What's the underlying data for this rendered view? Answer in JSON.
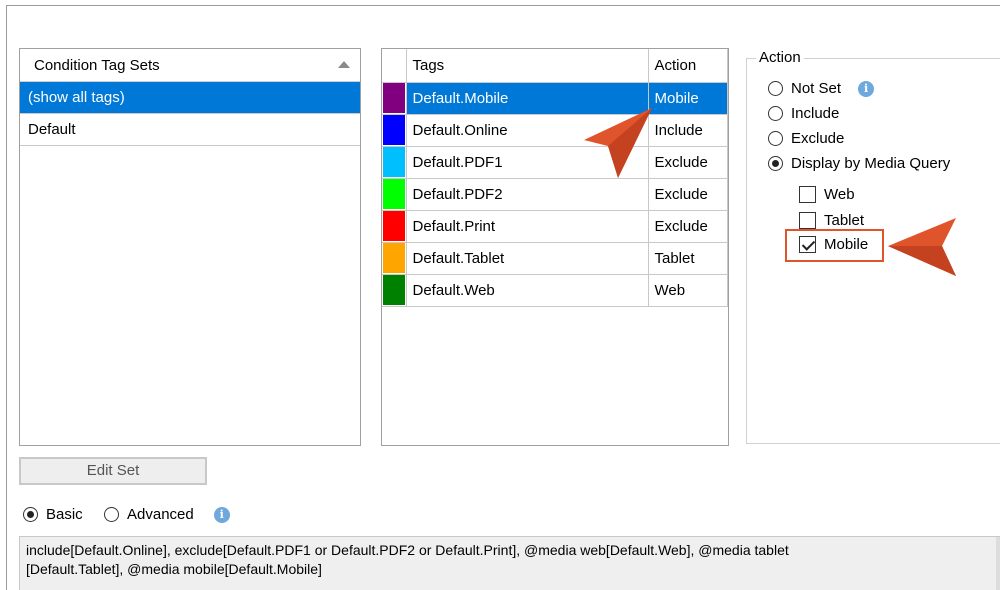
{
  "tag_sets": {
    "header": "Condition Tag Sets",
    "items": [
      {
        "label": "(show all tags)",
        "selected": true
      },
      {
        "label": "Default",
        "selected": false
      }
    ]
  },
  "tags_table": {
    "col_tags": "Tags",
    "col_action": "Action",
    "rows": [
      {
        "name": "Default.Mobile",
        "action": "Mobile",
        "color": "#800080",
        "selected": true
      },
      {
        "name": "Default.Online",
        "action": "Include",
        "color": "#0000ff",
        "selected": false
      },
      {
        "name": "Default.PDF1",
        "action": "Exclude",
        "color": "#00bfff",
        "selected": false
      },
      {
        "name": "Default.PDF2",
        "action": "Exclude",
        "color": "#00ff00",
        "selected": false
      },
      {
        "name": "Default.Print",
        "action": "Exclude",
        "color": "#ff0000",
        "selected": false
      },
      {
        "name": "Default.Tablet",
        "action": "Tablet",
        "color": "#ffa500",
        "selected": false
      },
      {
        "name": "Default.Web",
        "action": "Web",
        "color": "#008000",
        "selected": false
      }
    ]
  },
  "action": {
    "legend": "Action",
    "not_set": "Not Set",
    "include": "Include",
    "exclude": "Exclude",
    "display_by_media": "Display by Media Query",
    "web": "Web",
    "tablet": "Tablet",
    "mobile": "Mobile"
  },
  "edit_set": "Edit Set",
  "mode": {
    "basic": "Basic",
    "advanced": "Advanced"
  },
  "expression": {
    "line1": "include[Default.Online], exclude[Default.PDF1 or Default.PDF2 or Default.Print], @media web[Default.Web], @media tablet",
    "line2": "[Default.Tablet], @media mobile[Default.Mobile]"
  },
  "colors": {
    "selection": "#0078d7",
    "annotation": "#e0542c"
  }
}
